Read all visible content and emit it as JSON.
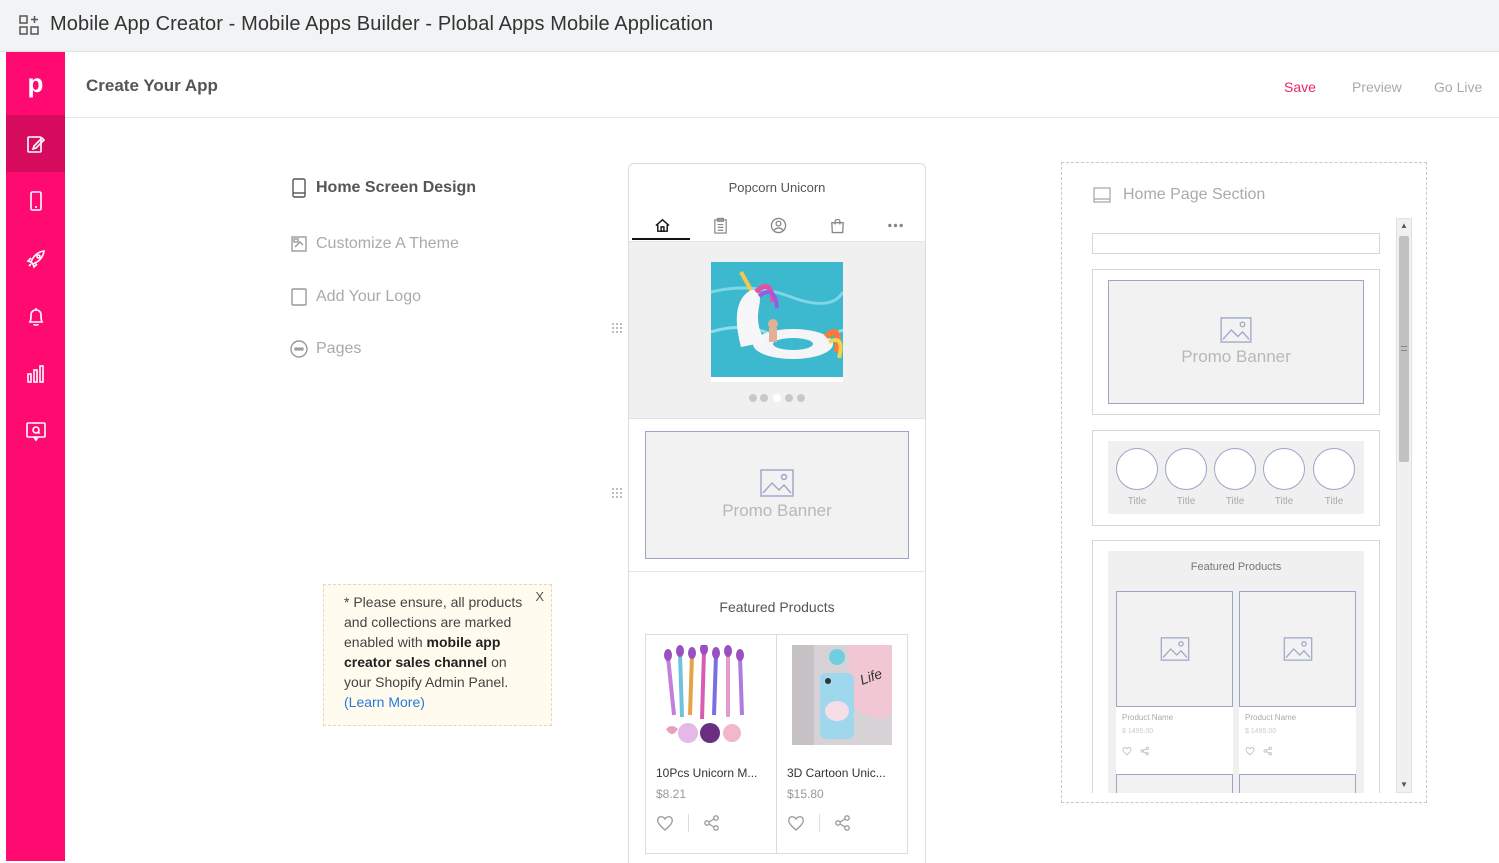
{
  "window": {
    "title": "Mobile App Creator - Mobile Apps Builder - Plobal Apps Mobile Application"
  },
  "sidebar": {
    "logo": "p",
    "items": [
      {
        "icon": "edit-icon",
        "active": true
      },
      {
        "icon": "mobile-icon",
        "active": false
      },
      {
        "icon": "rocket-icon",
        "active": false
      },
      {
        "icon": "bell-icon",
        "active": false
      },
      {
        "icon": "bar-chart-icon",
        "active": false
      },
      {
        "icon": "support-chat-icon",
        "active": false
      }
    ]
  },
  "header": {
    "title": "Create Your App",
    "save": "Save",
    "preview": "Preview",
    "go_live": "Go Live",
    "accent_color": "#e8246e"
  },
  "steps": [
    {
      "label": "Home Screen Design",
      "icon": "mobile-icon",
      "active": true
    },
    {
      "label": "Customize A Theme",
      "icon": "paint-icon",
      "active": false
    },
    {
      "label": "Add Your Logo",
      "icon": "square-icon",
      "active": false
    },
    {
      "label": "Pages",
      "icon": "pages-icon",
      "active": false
    }
  ],
  "note": {
    "close": "X",
    "text1": "* Please ensure, all products and collections are marked enabled with ",
    "bold": "mobile app creator sales channel",
    "text2": " on your Shopify Admin Panel. ",
    "link": "(Learn More)"
  },
  "phone": {
    "store_name": "Popcorn Unicorn",
    "tabs": [
      "home-icon",
      "clipboard-icon",
      "user-icon",
      "bag-icon",
      "more-icon"
    ],
    "promo_label": "Promo Banner",
    "featured_title": "Featured Products",
    "products": [
      {
        "name": "10Pcs Unicorn M...",
        "price": "$8.21"
      },
      {
        "name": "3D Cartoon Unic...",
        "price": "$15.80"
      }
    ]
  },
  "home_section": {
    "title": "Home Page Section",
    "promo_label": "Promo Banner",
    "circle_titles": [
      "Title",
      "Title",
      "Title",
      "Title",
      "Title"
    ],
    "featured_title": "Featured Products",
    "product_name": "Product Name",
    "product_price": "$ 1495.00"
  }
}
